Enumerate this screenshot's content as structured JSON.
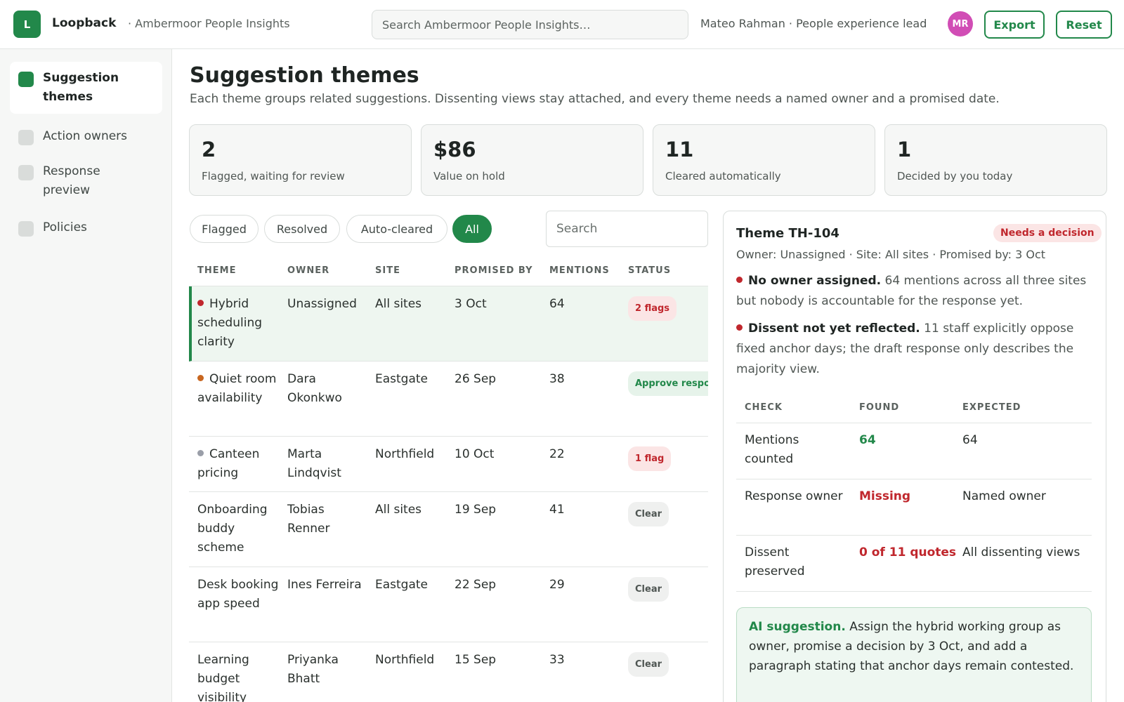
{
  "app": {
    "logo_letter": "L",
    "name": "Loopback",
    "org": "· Ambermoor People Insights",
    "search_placeholder": "Search Ambermoor People Insights…",
    "user": "Mateo Rahman · People experience lead",
    "avatar_initials": "MR",
    "export_label": "Export",
    "reset_label": "Reset",
    "accent_color": "#22884a"
  },
  "sidebar": {
    "items": [
      {
        "label": "Suggestion themes",
        "active": true
      },
      {
        "label": "Action owners",
        "active": false
      },
      {
        "label": "Response preview",
        "active": false
      },
      {
        "label": "Policies",
        "active": false
      }
    ]
  },
  "page": {
    "title": "Suggestion themes",
    "subtitle": "Each theme groups related suggestions. Dissenting views stay attached, and every theme needs a named owner and a promised date."
  },
  "stats": [
    {
      "value": "2",
      "label": "Flagged, waiting for review"
    },
    {
      "value": "$86",
      "label": "Value on hold"
    },
    {
      "value": "11",
      "label": "Cleared automatically"
    },
    {
      "value": "1",
      "label": "Decided by you today"
    }
  ],
  "filters": {
    "chips": [
      "Flagged",
      "Resolved",
      "Auto-cleared",
      "All"
    ],
    "active": "All",
    "search_placeholder": "Search"
  },
  "table": {
    "headers": [
      "THEME",
      "OWNER",
      "SITE",
      "PROMISED BY",
      "MENTIONS",
      "STATUS"
    ],
    "rows": [
      {
        "theme": "Hybrid scheduling clarity",
        "dot_color": "#c0272d",
        "owner": "Unassigned",
        "site": "All sites",
        "promised": "3 Oct",
        "mentions": "64",
        "status": "2 flags",
        "status_type": "red",
        "selected": true
      },
      {
        "theme": "Quiet room availability",
        "dot_color": "#c8661f",
        "owner": "Dara Okonkwo",
        "site": "Eastgate",
        "promised": "26 Sep",
        "mentions": "38",
        "status": "Approve response",
        "status_type": "green",
        "selected": false
      },
      {
        "theme": "Canteen pricing",
        "dot_color": "#9a9ea8",
        "owner": "Marta Lindqvist",
        "site": "Northfield",
        "promised": "10 Oct",
        "mentions": "22",
        "status": "1 flag",
        "status_type": "red",
        "selected": false
      },
      {
        "theme": "Onboarding buddy scheme",
        "dot_color": "",
        "owner": "Tobias Renner",
        "site": "All sites",
        "promised": "19 Sep",
        "mentions": "41",
        "status": "Clear",
        "status_type": "gray",
        "selected": false
      },
      {
        "theme": "Desk booking app speed",
        "dot_color": "",
        "owner": "Ines Ferreira",
        "site": "Eastgate",
        "promised": "22 Sep",
        "mentions": "29",
        "status": "Clear",
        "status_type": "gray",
        "selected": false
      },
      {
        "theme": "Learning budget visibility",
        "dot_color": "",
        "owner": "Priyanka Bhatt",
        "site": "Northfield",
        "promised": "15 Sep",
        "mentions": "33",
        "status": "Clear",
        "status_type": "gray",
        "selected": false
      }
    ]
  },
  "detail": {
    "title": "Theme TH-104",
    "badge": "Needs a decision",
    "meta": "Owner: Unassigned · Site: All sites · Promised by: 3 Oct",
    "issues": [
      {
        "head": "No owner assigned.",
        "text": " 64 mentions across all three sites but nobody is accountable for the response yet."
      },
      {
        "head": "Dissent not yet reflected.",
        "text": " 11 staff explicitly oppose fixed anchor days; the draft response only describes the majority view."
      }
    ],
    "checks": {
      "headers": [
        "CHECK",
        "FOUND",
        "EXPECTED"
      ],
      "rows": [
        {
          "check": "Mentions counted",
          "found": "64",
          "found_state": "ok",
          "expected": "64"
        },
        {
          "check": "Response owner",
          "found": "Missing",
          "found_state": "bad",
          "expected": "Named owner"
        },
        {
          "check": "Dissent preserved",
          "found": "0 of 11 quotes",
          "found_state": "bad",
          "expected": "All dissenting views"
        }
      ]
    },
    "ai_head": "AI suggestion.",
    "ai_text": " Assign the hybrid working group as owner, promise a decision by 3 Oct, and add a paragraph stating that anchor days remain contested."
  }
}
